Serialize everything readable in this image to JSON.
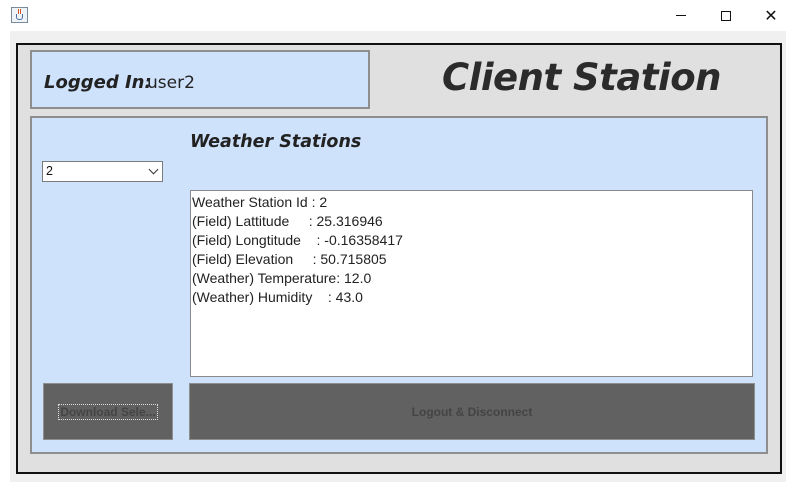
{
  "window": {
    "controls": {
      "minimize": "—",
      "maximize": "☐",
      "close": "✕"
    }
  },
  "header": {
    "login_label": "Logged In:",
    "username": "user2",
    "app_title": "Client Station"
  },
  "stations": {
    "title": "Weather Stations",
    "selected": "2"
  },
  "details": {
    "lines": [
      "Weather Station Id : 2",
      "(Field) Lattitude     : 25.316946",
      "(Field) Longtitude    : -0.16358417",
      "(Field) Elevation     : 50.715805",
      "(Weather) Temperature: 12.0",
      "(Weather) Humidity    : 43.0"
    ]
  },
  "buttons": {
    "download": "Download Sele...",
    "logout": "Logout & Disconnect"
  },
  "colors": {
    "panel": "#cfe2fb",
    "background": "#e0e0e0",
    "button": "#616161"
  }
}
